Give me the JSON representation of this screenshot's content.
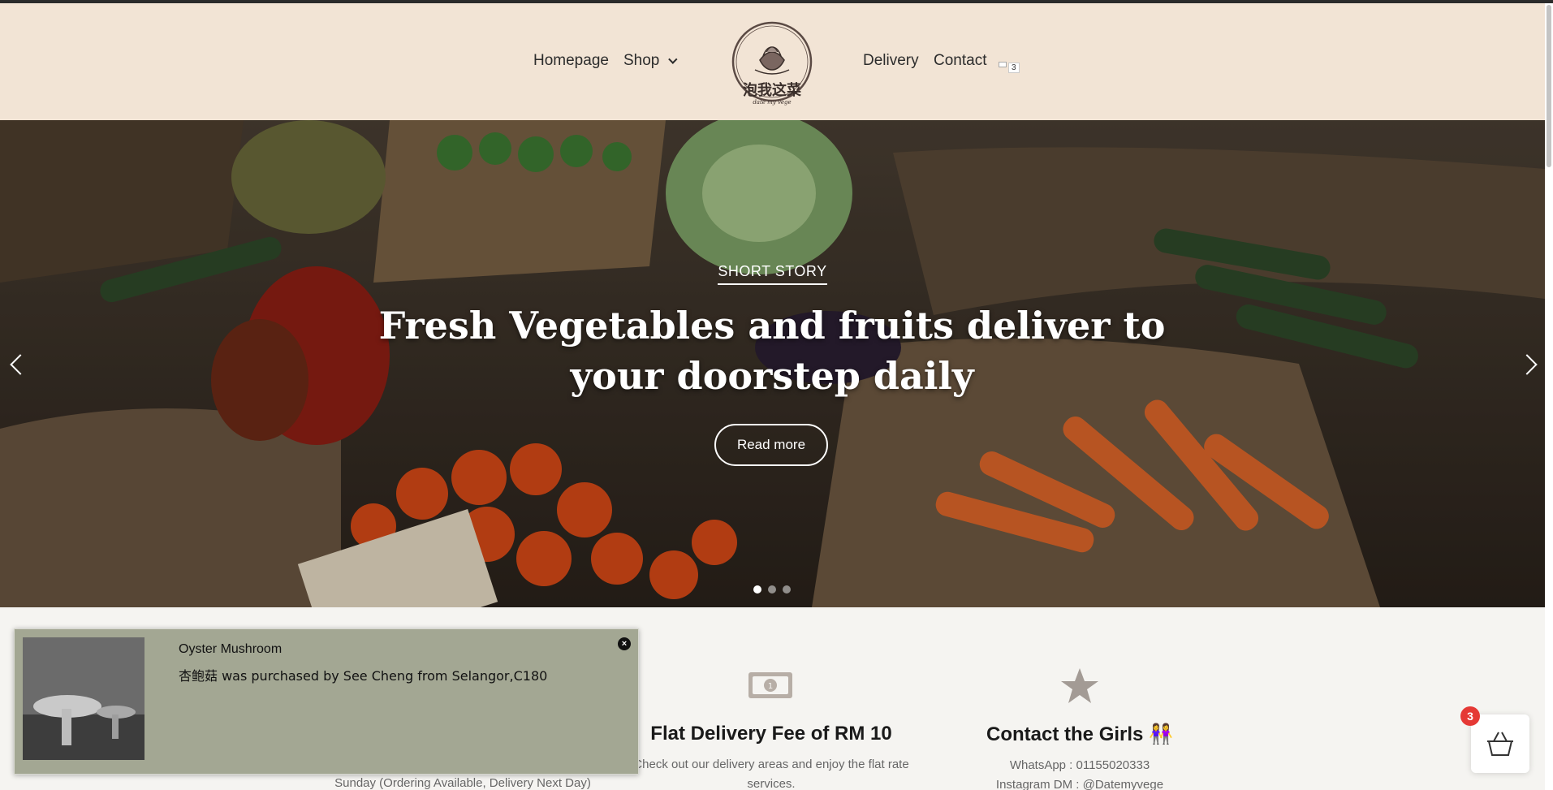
{
  "nav": {
    "homepage": "Homepage",
    "shop": "Shop",
    "delivery": "Delivery",
    "contact": "Contact",
    "cart_count": "3"
  },
  "logo": {
    "text": "泡我这菜",
    "subtext": "date my vege"
  },
  "hero": {
    "eyebrow": "SHORT STORY",
    "title": "Fresh Vegetables and fruits deliver to your doorstep daily",
    "button": "Read more",
    "slides": 3,
    "active_slide": 1
  },
  "features": {
    "delivery_title": "Flat Delivery Fee of RM 10",
    "delivery_text": "Check out our delivery areas and enjoy the flat rate services.",
    "contact_title": "Contact the Girls 👭",
    "contact_whatsapp": "WhatsApp : 01155020333",
    "contact_instagram": "Instagram DM : @Datemyvege",
    "sunday_text": "Sunday (Ordering Available, Delivery Next Day)"
  },
  "popup": {
    "product": "Oyster Mushroom",
    "message": "杏鲍菇 was purchased by See Cheng from Selangor,C180"
  },
  "cart": {
    "count": "3"
  },
  "colors": {
    "header_bg": "#f2e4d5",
    "popup_bg": "#a3a793",
    "badge": "#e53935"
  }
}
